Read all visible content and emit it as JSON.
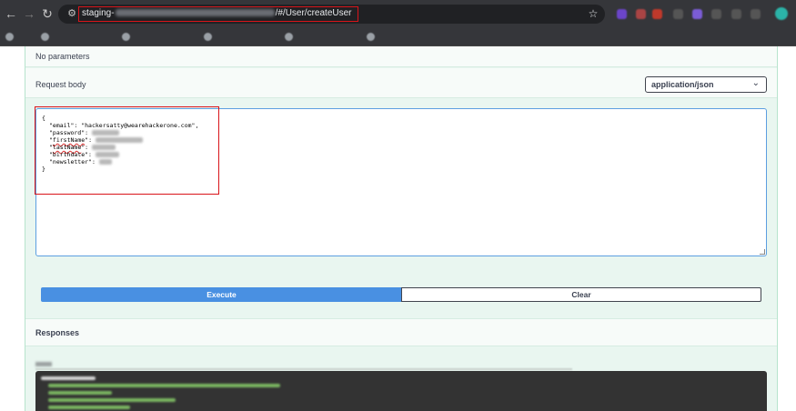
{
  "browser": {
    "url_visible_start": "staging-",
    "url_visible_end": "/#/User/createUser",
    "icons": {
      "back": "back-arrow-icon",
      "forward": "forward-arrow-icon",
      "reload": "reload-icon",
      "site_info": "site-settings-icon",
      "star": "star-icon"
    }
  },
  "swagger": {
    "parameters_text": "No parameters",
    "request_body_label": "Request body",
    "content_type": "application/json",
    "body": {
      "open_brace": "{",
      "email_line": "\"email\": \"hackersatty@wearehackerone.com\",",
      "password_key": "\"password\":",
      "firstname_key": "firstName",
      "lastname_key": "lastName",
      "birthdate_key": "\"birthdate\":",
      "newsletter_key": "\"newsletter\":",
      "close_brace": "}"
    },
    "execute_label": "Execute",
    "clear_label": "Clear",
    "responses_label": "Responses"
  },
  "colors": {
    "execute_bg": "#4990e2",
    "highlight": "#d9141a",
    "op_bg": "#e9f6f0"
  }
}
